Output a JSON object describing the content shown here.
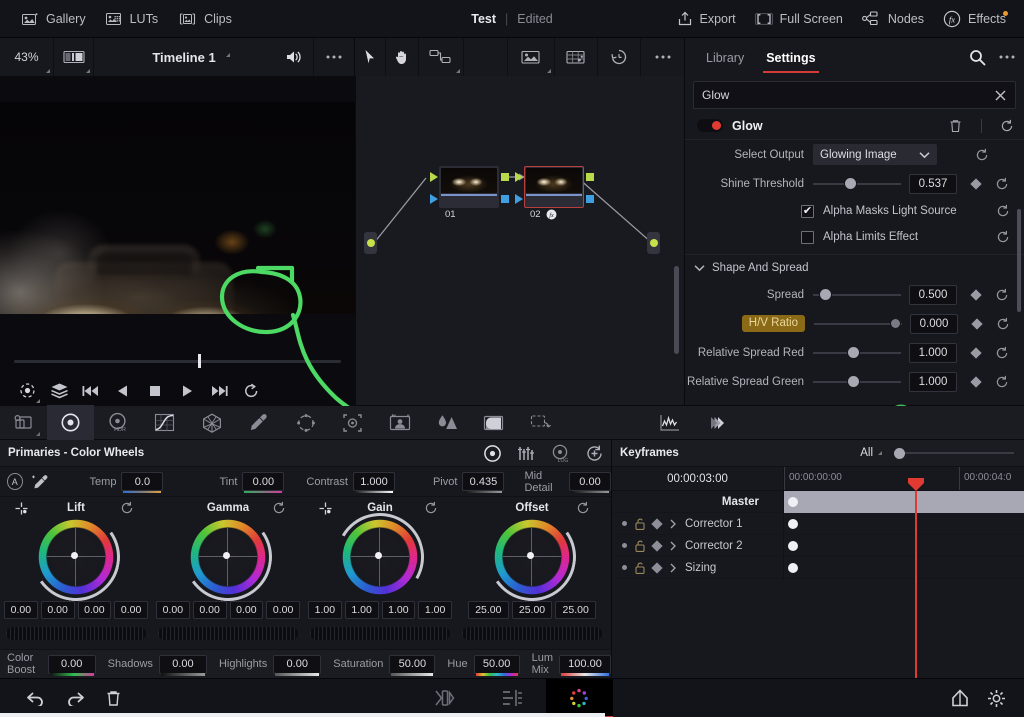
{
  "topbar": {
    "left_items": [
      {
        "label": "Gallery",
        "icon": "gallery-icon"
      },
      {
        "label": "LUTs",
        "icon": "luts-icon"
      },
      {
        "label": "Clips",
        "icon": "clips-icon"
      }
    ],
    "project_name": "Test",
    "separator": "|",
    "project_state": "Edited",
    "right_items": [
      {
        "label": "Export",
        "icon": "export-icon"
      },
      {
        "label": "Full Screen",
        "icon": "fullscreen-icon"
      },
      {
        "label": "Nodes",
        "icon": "nodes-icon"
      },
      {
        "label": "Effects",
        "icon": "effects-fx-icon"
      }
    ]
  },
  "viewer_bar": {
    "zoom": "43%",
    "timeline_name": "Timeline 1",
    "audio_icon": "speaker-icon",
    "more_icon": "ellipsis-icon",
    "split_icon": "split-view-icon"
  },
  "node_toolbar": {
    "tools": [
      "cursor-icon",
      "hand-icon",
      "node-graph-icon",
      "image-node-icon",
      "grid-node-icon",
      "version-history-icon",
      "ellipsis-icon"
    ]
  },
  "inspector": {
    "tabs": [
      {
        "label": "Library",
        "active": false
      },
      {
        "label": "Settings",
        "active": true
      }
    ],
    "search_icon": "search-icon",
    "more_icon": "ellipsis-icon",
    "search": {
      "value": "Glow",
      "placeholder": "Search",
      "clear_icon": "close-icon"
    },
    "effect": {
      "name": "Glow",
      "enabled": true,
      "delete_icon": "trash-icon",
      "reset_icon": "reset-icon"
    },
    "params": [
      {
        "type": "dropdown",
        "label": "Select Output",
        "value": "Glowing Image",
        "reset_icon": "reset-icon",
        "chevron": "chevron-down-icon"
      },
      {
        "type": "slider",
        "label": "Shine Threshold",
        "value": "0.537",
        "slider_pct": 42,
        "keyframe": true,
        "reset_icon": "reset-icon"
      },
      {
        "type": "checkbox",
        "label": "Alpha Masks Light Source",
        "checked": true,
        "reset_icon": "reset-icon"
      },
      {
        "type": "checkbox",
        "label": "Alpha Limits Effect",
        "checked": false,
        "reset_icon": "reset-icon"
      }
    ],
    "section": {
      "title": "Shape And Spread",
      "expanded": true,
      "chevron": "chevron-down-icon",
      "params": [
        {
          "type": "slider",
          "label": "Spread",
          "value": "0.500",
          "slider_pct": 14,
          "keyframe": true,
          "reset_icon": "reset-icon",
          "highlighted": false
        },
        {
          "type": "slider",
          "label": "H/V Ratio",
          "value": "0.000",
          "slider_pct": 92,
          "keyframe": true,
          "reset_icon": "reset-icon",
          "highlighted": true
        },
        {
          "type": "slider",
          "label": "Relative Spread Red",
          "value": "1.000",
          "slider_pct": 45,
          "keyframe": true,
          "reset_icon": "reset-icon",
          "highlighted": false
        },
        {
          "type": "slider",
          "label": "Relative Spread Green",
          "value": "1.000",
          "slider_pct": 45,
          "keyframe": true,
          "reset_icon": "reset-icon",
          "highlighted": false
        }
      ]
    }
  },
  "nodes": [
    {
      "number": "01",
      "selected": false,
      "has_fx": false
    },
    {
      "number": "02",
      "selected": true,
      "has_fx": true
    }
  ],
  "palette_toolbar": {
    "tools": [
      "camera-raw-icon",
      "color-wheels-icon",
      "hdr-wheels-icon",
      "curves-icon",
      "color-warper-icon",
      "qualifier-eyedropper-icon",
      "power-window-icon",
      "tracker-icon",
      "magic-mask-icon",
      "blur-icon",
      "key-icon",
      "sizing-icon",
      "scopes-icon",
      "stills-icon"
    ],
    "active_index": 1
  },
  "primaries": {
    "title": "Primaries - Color Wheels",
    "mode_icons": [
      "primaries-wheels-icon",
      "primaries-bars-icon",
      "log-wheels-icon",
      "reset-all-icon"
    ],
    "auto_balance": "A",
    "picker_icon": "auto-picker-icon",
    "controls": [
      {
        "label": "Temp",
        "value": "0.0",
        "bar": "temp"
      },
      {
        "label": "Tint",
        "value": "0.00",
        "bar": "tint"
      },
      {
        "label": "Contrast",
        "value": "1.000",
        "bar": "wht"
      },
      {
        "label": "Pivot",
        "value": "0.435",
        "bar": "gry"
      },
      {
        "label": "Mid Detail",
        "value": "0.00",
        "bar": "gry"
      }
    ],
    "wheels": [
      {
        "name": "Lift",
        "has_picker": true,
        "values": [
          "0.00",
          "0.00",
          "0.00",
          "0.00"
        ],
        "channels": 4
      },
      {
        "name": "Gamma",
        "has_picker": false,
        "values": [
          "0.00",
          "0.00",
          "0.00",
          "0.00"
        ],
        "channels": 4
      },
      {
        "name": "Gain",
        "has_picker": true,
        "values": [
          "1.00",
          "1.00",
          "1.00",
          "1.00"
        ],
        "channels": 4
      },
      {
        "name": "Offset",
        "has_picker": false,
        "values": [
          "25.00",
          "25.00",
          "25.00"
        ],
        "channels": 3
      }
    ],
    "bottom_controls": [
      {
        "label": "Color Boost",
        "value": "0.00",
        "bar": "cb"
      },
      {
        "label": "Shadows",
        "value": "0.00",
        "bar": "gry"
      },
      {
        "label": "Highlights",
        "value": "0.00",
        "bar": "sat"
      },
      {
        "label": "Saturation",
        "value": "50.00",
        "bar": "sat"
      },
      {
        "label": "Hue",
        "value": "50.00",
        "bar": "hue"
      },
      {
        "label": "Lum Mix",
        "value": "100.00",
        "bar": "lum"
      }
    ]
  },
  "keyframes": {
    "title": "Keyframes",
    "filter": "All",
    "current_timecode": "00:00:03:00",
    "ruler_ticks": [
      "00:00:00:00",
      "00:00:04:0"
    ],
    "rows": [
      {
        "name": "Master",
        "is_master": true,
        "locked": false
      },
      {
        "name": "Corrector 1",
        "is_master": false,
        "locked": true,
        "expand": "chevron-right-icon"
      },
      {
        "name": "Corrector 2",
        "is_master": false,
        "locked": true,
        "expand": "chevron-right-icon"
      },
      {
        "name": "Sizing",
        "is_master": false,
        "locked": true,
        "expand": "chevron-right-icon"
      }
    ]
  },
  "footer": {
    "left_icons": [
      "undo-icon",
      "redo-icon",
      "trash-icon"
    ],
    "pages": [
      {
        "icon": "cut-page-icon",
        "active": false
      },
      {
        "icon": "edit-page-icon",
        "active": false
      },
      {
        "icon": "color-page-icon",
        "active": true
      }
    ],
    "right_icons": [
      "home-icon",
      "settings-gear-icon"
    ]
  },
  "annotation": {
    "color": "#4cd964",
    "shape": "circle-with-arrow-to-hv-ratio"
  }
}
